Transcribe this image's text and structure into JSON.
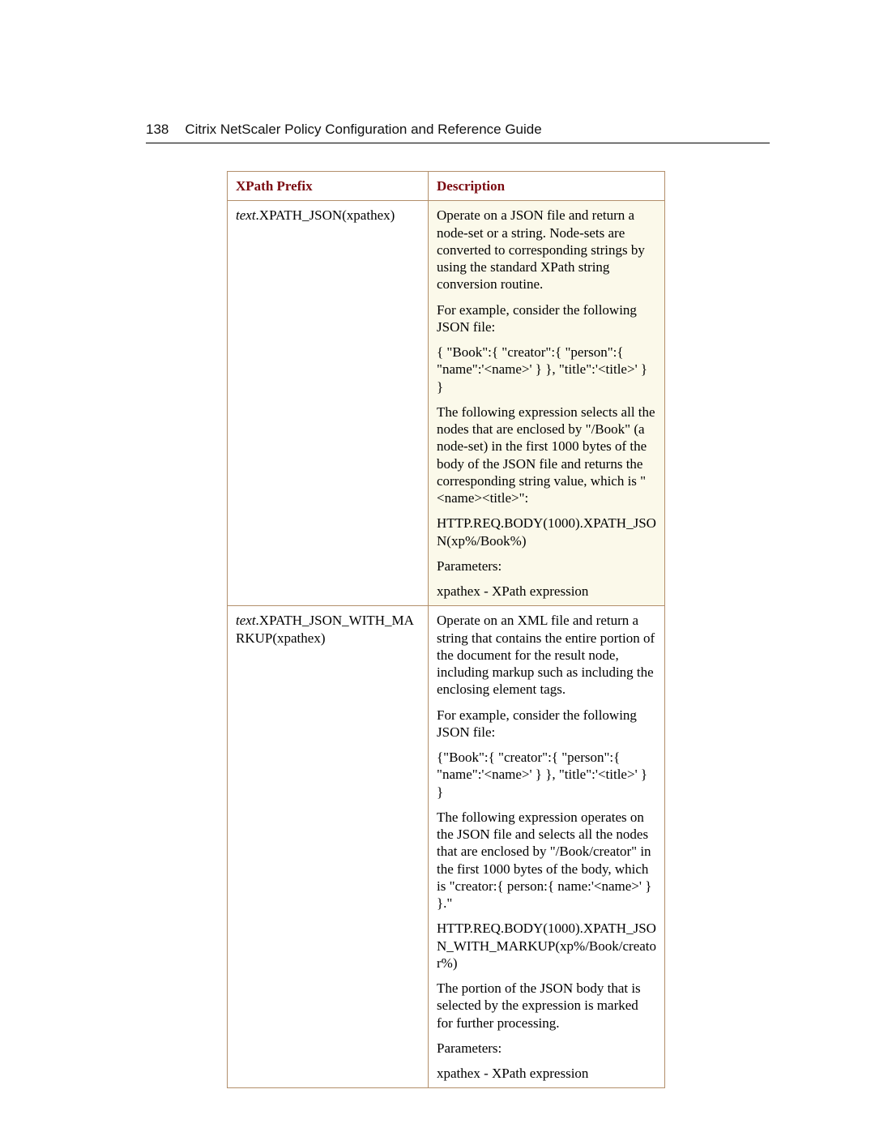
{
  "header": {
    "page_number": "138",
    "title": "Citrix NetScaler Policy Configuration and Reference Guide"
  },
  "table": {
    "headers": {
      "col1": "XPath Prefix",
      "col2": "Description"
    },
    "rows": [
      {
        "prefix_italic": "text",
        "prefix_rest": ".XPATH_JSON(xpathex)",
        "paras": [
          "Operate on a JSON file and return a node-set or a string. Node-sets are converted to corresponding strings by using the standard XPath string conversion routine.",
          "For example, consider the following JSON file:",
          "{ \"Book\":{ \"creator\":{ \"person\":{ \"name\":'<name>' } }, \"title\":'<title>' } }",
          "The following expression selects all the nodes that are enclosed by \"/Book\" (a node-set) in the first 1000 bytes of the body of the JSON file and returns the corresponding string value, which is \"<name><title>\":",
          "HTTP.REQ.BODY(1000).XPATH_JSON(xp%/Book%)",
          "Parameters:",
          "xpathex - XPath expression"
        ]
      },
      {
        "prefix_italic": "text",
        "prefix_rest": ".XPATH_JSON_WITH_MARKUP(xpathex)",
        "paras": [
          "Operate on an XML file and return a string that contains the entire portion of the document for the result node, including markup such as including the enclosing element tags.",
          "For example, consider the following JSON file:",
          "{\"Book\":{ \"creator\":{ \"person\":{ \"name\":'<name>' } }, \"title\":'<title>' } }",
          "The following expression operates on the JSON file and selects all the nodes that are enclosed by \"/Book/creator\" in the first 1000 bytes of the body, which is \"creator:{ person:{ name:'<name>' } }.\"",
          "HTTP.REQ.BODY(1000).XPATH_JSON_WITH_MARKUP(xp%/Book/creator%)",
          "The portion of the JSON body that is selected by the expression is marked for further processing.",
          "Parameters:",
          "xpathex - XPath expression"
        ]
      }
    ]
  }
}
